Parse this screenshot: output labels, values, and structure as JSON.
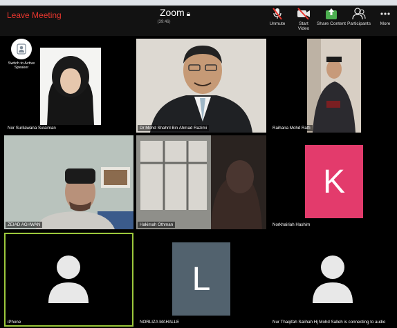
{
  "toolbar": {
    "leave_label": "Leave Meeting",
    "title": "Zoom",
    "lock_icon": "lock-icon",
    "duration": "(39:46)",
    "buttons": [
      {
        "label": "Unmute",
        "icon": "mic-muted-icon"
      },
      {
        "label": "Start Video",
        "icon": "video-off-icon"
      },
      {
        "label": "Share Content",
        "icon": "share-icon"
      },
      {
        "label": "Participants",
        "icon": "participants-icon"
      },
      {
        "label": "More",
        "icon": "more-icon"
      }
    ]
  },
  "switch_speaker": {
    "label": "Switch to Active Speaker",
    "icon": "switch-speaker-icon"
  },
  "participants": [
    {
      "name": "Nor Surilawana Sulaiman",
      "kind": "video"
    },
    {
      "name": "Dr Mohd Shahril Bin Ahmad Razimi",
      "kind": "video"
    },
    {
      "name": "Raihana Mohd Raffi",
      "kind": "video"
    },
    {
      "name": "ZEIAD AGHWAN",
      "kind": "video"
    },
    {
      "name": "Hakimah Othman",
      "kind": "video"
    },
    {
      "name": "Norkhairiah Hashim",
      "kind": "avatar",
      "letter": "K"
    },
    {
      "name": "iPhone",
      "kind": "silhouette",
      "active": true
    },
    {
      "name": "NORLIZA MAHALLE",
      "kind": "avatar",
      "letter": "L"
    },
    {
      "name": "Nur Thaqifah Salihah Hj Mohd Salleh is connecting to audio",
      "kind": "silhouette"
    }
  ],
  "colors": {
    "leave": "#e8362e",
    "active_speaker_border": "#9cc83c",
    "avatar_k_bg": "#e33b6c",
    "avatar_l_bg": "#52626e"
  }
}
